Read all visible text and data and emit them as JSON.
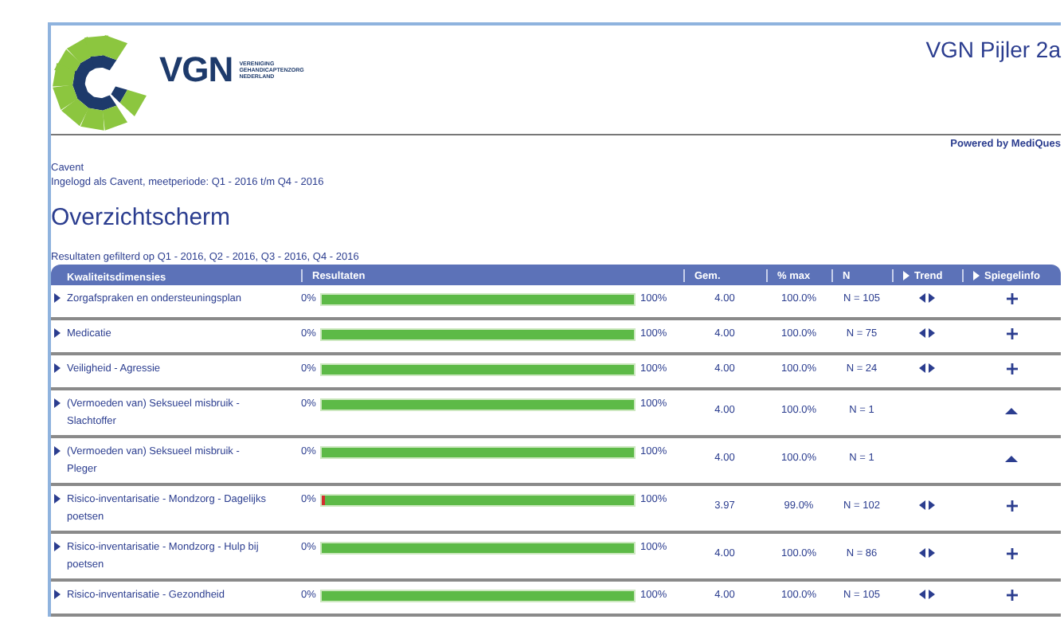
{
  "logo": {
    "wordmark": "VGN",
    "tagline": [
      "VERENIGING",
      "GEHANDICAPTENZORG",
      "NEDERLAND"
    ]
  },
  "header": {
    "title": "VGN Pijler 2a",
    "powered_by": "Powered by MediQues"
  },
  "user": {
    "organisation": "Cavent",
    "login_line": "Ingelogd als Cavent, meetperiode: Q1 - 2016 t/m Q4 - 2016"
  },
  "page_title": "Overzichtscherm",
  "filter_text": "Resultaten gefilterd op Q1 - 2016, Q2 - 2016, Q3 - 2016, Q4 - 2016",
  "table": {
    "columns": [
      {
        "label": "Kwaliteitsdimensies",
        "arrow": false
      },
      {
        "label": "Resultaten",
        "arrow": false
      },
      {
        "label": "Gem.",
        "arrow": false
      },
      {
        "label": "% max",
        "arrow": false
      },
      {
        "label": "N",
        "arrow": false
      },
      {
        "label": "Trend",
        "arrow": true
      },
      {
        "label": "Spiegelinfo",
        "arrow": true
      }
    ],
    "rows": [
      {
        "name": "Zorgafspraken en ondersteuningsplan",
        "min": "0%",
        "max": "100%",
        "level": 1,
        "avg": "4.00",
        "pct": "100.0%",
        "n": "N = 105",
        "trend": true,
        "expanded": false
      },
      {
        "name": "Medicatie",
        "min": "0%",
        "max": "100%",
        "level": 1,
        "avg": "4.00",
        "pct": "100.0%",
        "n": "N = 75",
        "trend": true,
        "expanded": false
      },
      {
        "name": "Veiligheid - Agressie",
        "min": "0%",
        "max": "100%",
        "level": 1,
        "avg": "4.00",
        "pct": "100.0%",
        "n": "N = 24",
        "trend": true,
        "expanded": false
      },
      {
        "name": "(Vermoeden van) Seksueel misbruik - Slachtoffer",
        "min": "0%",
        "max": "100%",
        "level": 1,
        "avg": "4.00",
        "pct": "100.0%",
        "n": "N = 1",
        "trend": false,
        "expanded": true
      },
      {
        "name": "(Vermoeden van) Seksueel misbruik - Pleger",
        "min": "0%",
        "max": "100%",
        "level": 1,
        "avg": "4.00",
        "pct": "100.0%",
        "n": "N = 1",
        "trend": false,
        "expanded": true
      },
      {
        "name": "Risico-inventarisatie - Mondzorg - Dagelijks poetsen",
        "min": "0%",
        "max": "100%",
        "level": 0.99,
        "avg": "3.97",
        "pct": "99.0%",
        "n": "N = 102",
        "trend": true,
        "expanded": false
      },
      {
        "name": "Risico-inventarisatie - Mondzorg - Hulp bij poetsen",
        "min": "0%",
        "max": "100%",
        "level": 1,
        "avg": "4.00",
        "pct": "100.0%",
        "n": "N = 86",
        "trend": true,
        "expanded": false
      },
      {
        "name": "Risico-inventarisatie - Gezondheid",
        "min": "0%",
        "max": "100%",
        "level": 1,
        "avg": "4.00",
        "pct": "100.0%",
        "n": "N = 105",
        "trend": true,
        "expanded": false
      }
    ]
  }
}
